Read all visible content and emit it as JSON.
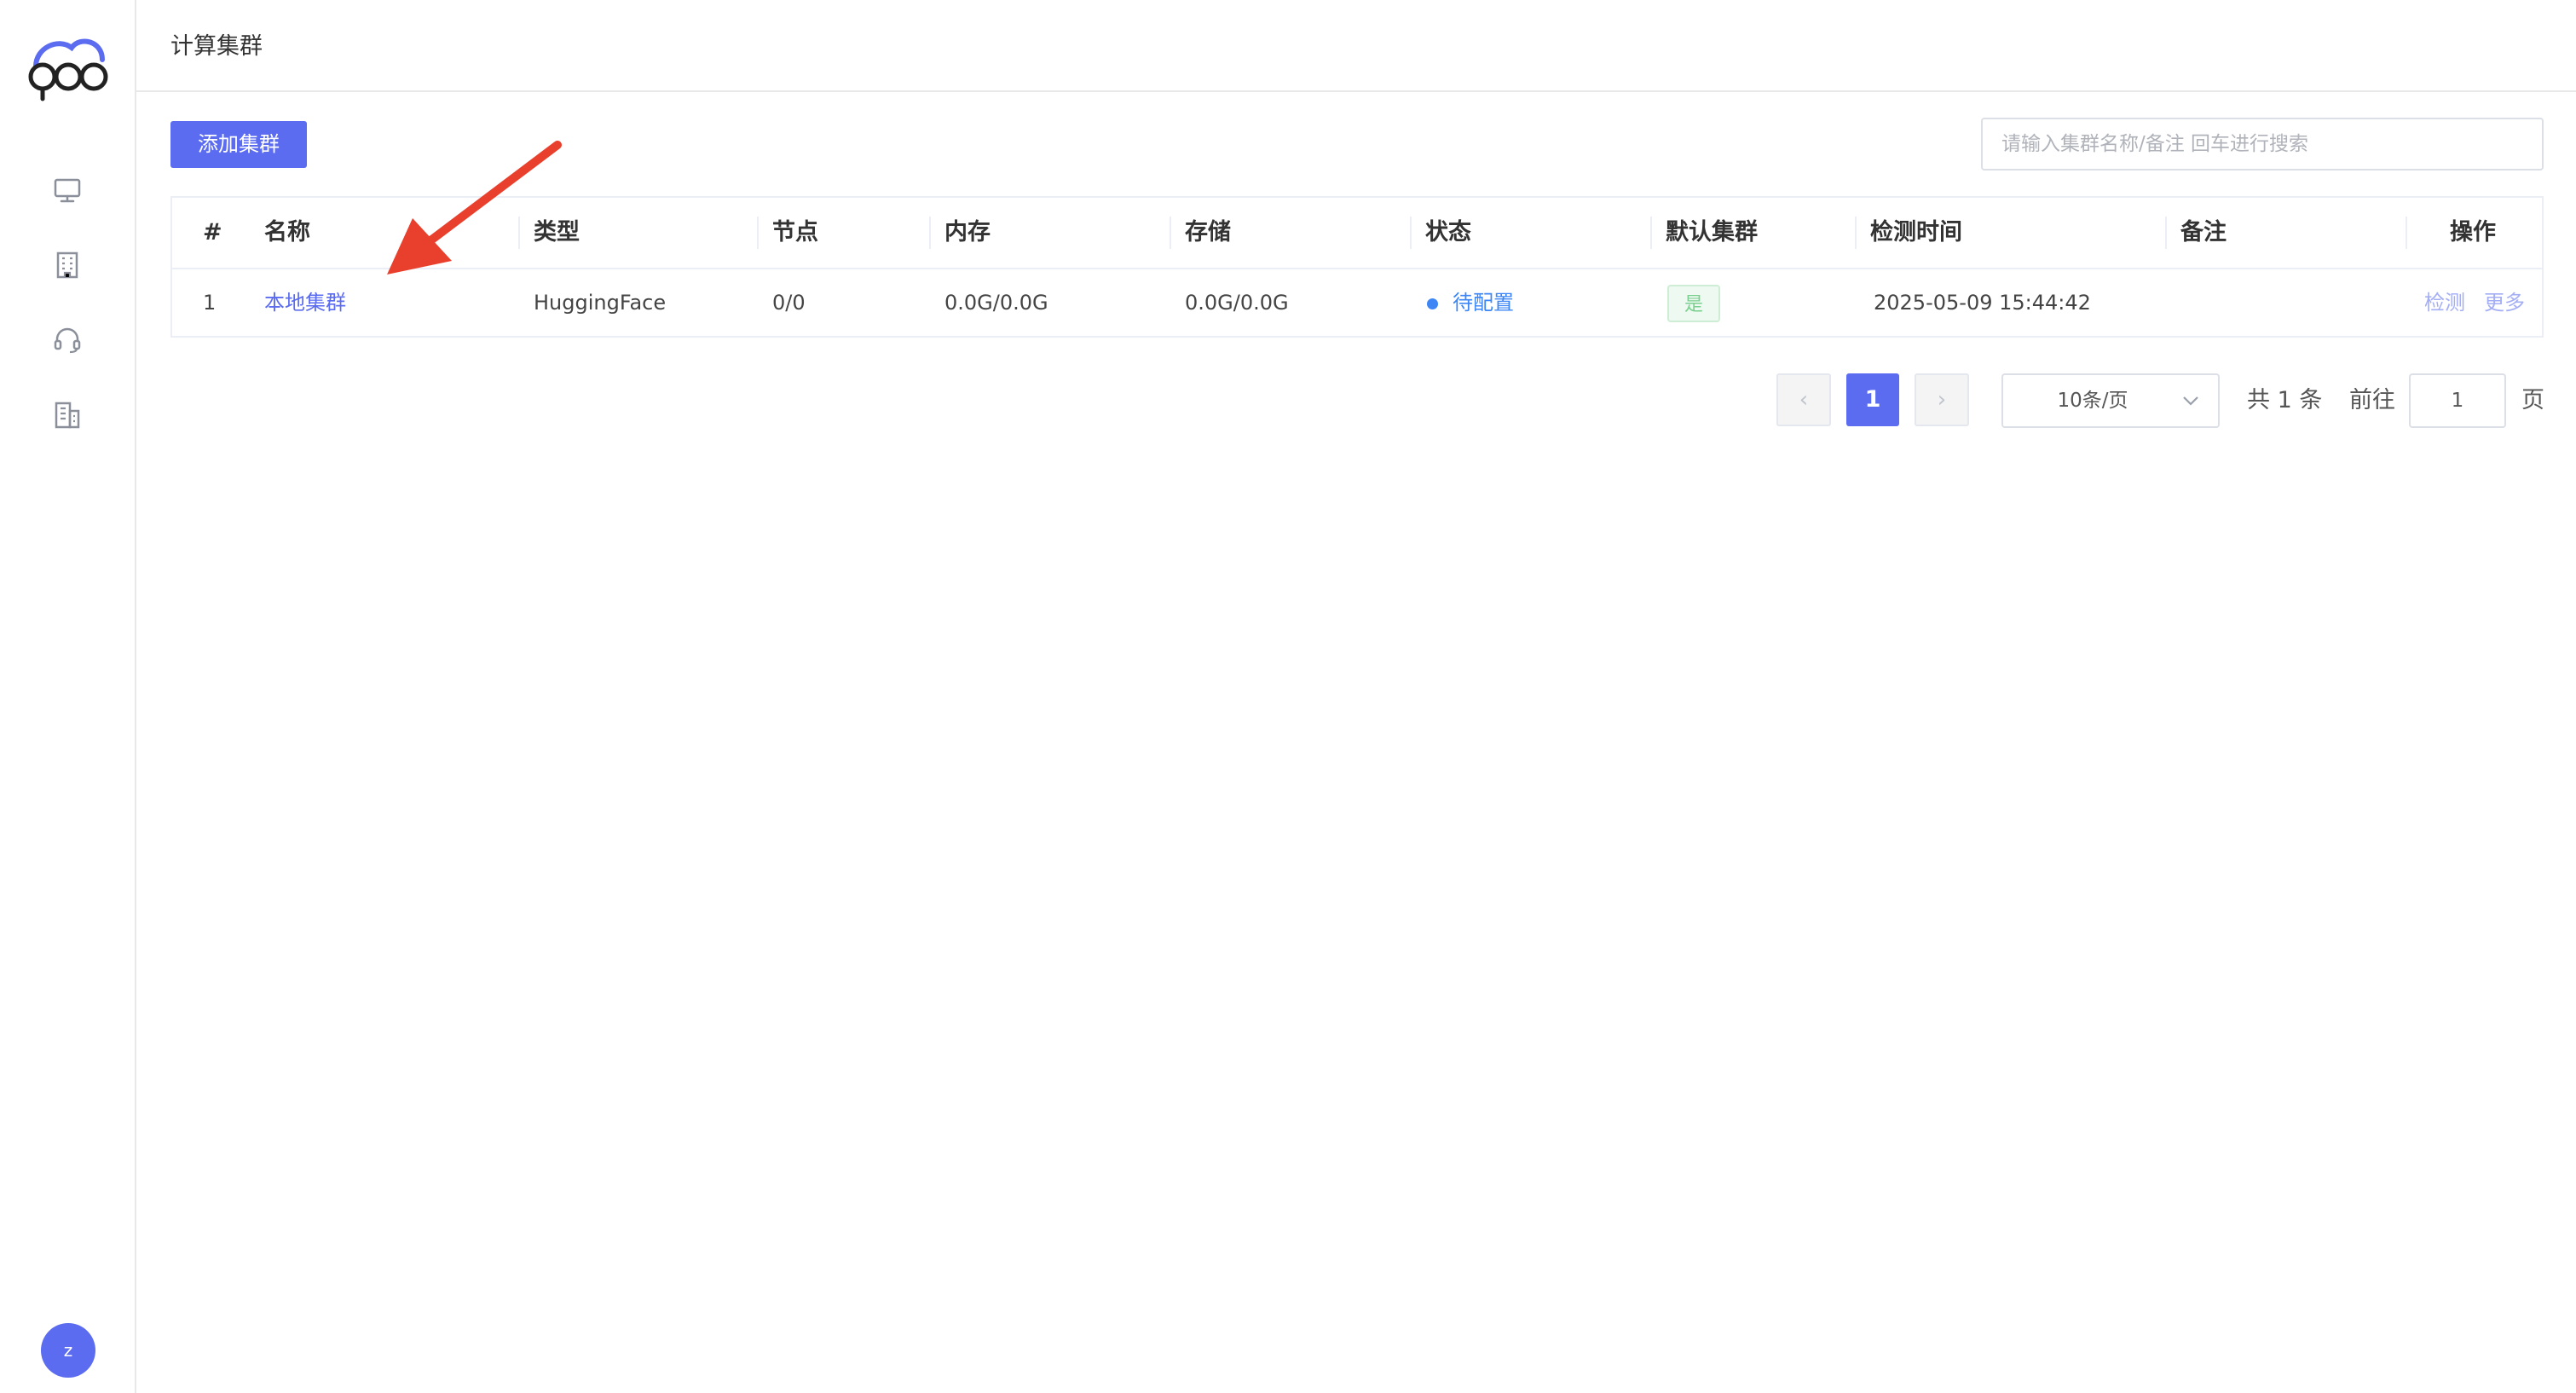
{
  "sidebar": {
    "icons": [
      {
        "name": "monitor-icon"
      },
      {
        "name": "building-icon"
      },
      {
        "name": "headset-icon"
      },
      {
        "name": "office-icon"
      }
    ],
    "avatar_letter": "z",
    "accent_color": "#5b6cf0"
  },
  "header": {
    "title": "计算集群"
  },
  "toolbar": {
    "add_label": "添加集群",
    "search_placeholder": "请输入集群名称/备注 回车进行搜索",
    "search_value": ""
  },
  "table": {
    "columns": [
      "#",
      "名称",
      "类型",
      "节点",
      "内存",
      "存储",
      "状态",
      "默认集群",
      "检测时间",
      "备注",
      "操作"
    ],
    "rows": [
      {
        "index": "1",
        "name": "本地集群",
        "type": "HuggingFace",
        "nodes": "0/0",
        "memory": "0.0G/0.0G",
        "storage": "0.0G/0.0G",
        "status": "待配置",
        "default": "是",
        "checked_at": "2025-05-09 15:44:42",
        "remark": "",
        "actions": [
          "检测",
          "更多"
        ]
      }
    ]
  },
  "pagination": {
    "prev_label": "‹",
    "current_page": "1",
    "next_label": "›",
    "page_size": "10条/页",
    "total_text": "共 1 条",
    "goto_label": "前往",
    "goto_value": "1",
    "page_unit": "页"
  },
  "colors": {
    "primary": "#5b6cf0",
    "status_blue": "#3d86f5",
    "success_green": "#7bcf8f",
    "annotation_red": "#e8402c"
  }
}
